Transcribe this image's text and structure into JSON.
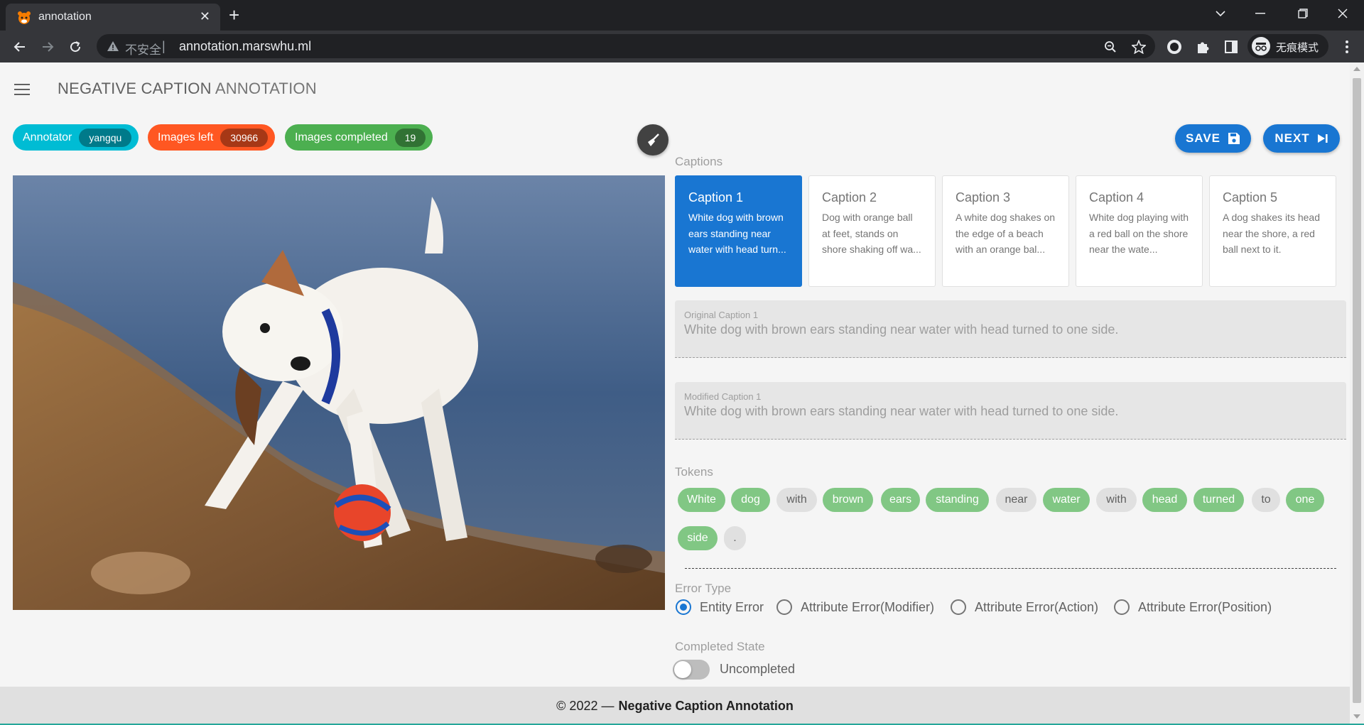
{
  "browser": {
    "tab_title": "annotation",
    "insecure_label": "不安全",
    "url": "annotation.marswhu.ml",
    "profile_label": "无痕模式"
  },
  "header": {
    "title_strong": "NEGATIVE CAPTION",
    "title_light": "ANNOTATION"
  },
  "stats": {
    "annotator_label": "Annotator",
    "annotator_value": "yangqu",
    "images_left_label": "Images left",
    "images_left_value": "30966",
    "images_completed_label": "Images completed",
    "images_completed_value": "19",
    "colors": {
      "annotator": "#00bcd4",
      "left": "#ff5722",
      "completed": "#4caf50"
    }
  },
  "actions": {
    "save_label": "SAVE",
    "next_label": "NEXT"
  },
  "captions": {
    "section_label": "Captions",
    "items": [
      {
        "title": "Caption 1",
        "text": "White dog with brown ears standing near water with head turn...",
        "active": true
      },
      {
        "title": "Caption 2",
        "text": "Dog with orange ball at feet, stands on shore shaking off wa...",
        "active": false
      },
      {
        "title": "Caption 3",
        "text": "A white dog shakes on the edge of a beach with an orange bal...",
        "active": false
      },
      {
        "title": "Caption 4",
        "text": "White dog playing with a red ball on the shore near the wate...",
        "active": false
      },
      {
        "title": "Caption 5",
        "text": "A dog shakes its head near the shore, a red ball next to it.",
        "active": false
      }
    ]
  },
  "original_caption": {
    "label": "Original Caption 1",
    "value": "White dog with brown ears standing near water with head turned to one side."
  },
  "modified_caption": {
    "label": "Modified Caption 1",
    "value": "White dog with brown ears standing near water with head turned to one side."
  },
  "tokens": {
    "section_label": "Tokens",
    "items": [
      {
        "text": "White",
        "on": true
      },
      {
        "text": "dog",
        "on": true
      },
      {
        "text": "with",
        "on": false
      },
      {
        "text": "brown",
        "on": true
      },
      {
        "text": "ears",
        "on": true
      },
      {
        "text": "standing",
        "on": true
      },
      {
        "text": "near",
        "on": false
      },
      {
        "text": "water",
        "on": true
      },
      {
        "text": "with",
        "on": false
      },
      {
        "text": "head",
        "on": true
      },
      {
        "text": "turned",
        "on": true
      },
      {
        "text": "to",
        "on": false
      },
      {
        "text": "one",
        "on": true
      },
      {
        "text": "side",
        "on": true
      },
      {
        "text": ".",
        "on": false
      }
    ]
  },
  "error_type": {
    "section_label": "Error Type",
    "options": [
      "Entity Error",
      "Attribute Error(Modifier)",
      "Attribute Error(Action)",
      "Attribute Error(Position)"
    ],
    "selected": "Entity Error"
  },
  "completed_state": {
    "section_label": "Completed State",
    "value_label": "Uncompleted",
    "on": false
  },
  "footer": {
    "prefix": "© 2022 —",
    "name": "Negative Caption Annotation"
  }
}
